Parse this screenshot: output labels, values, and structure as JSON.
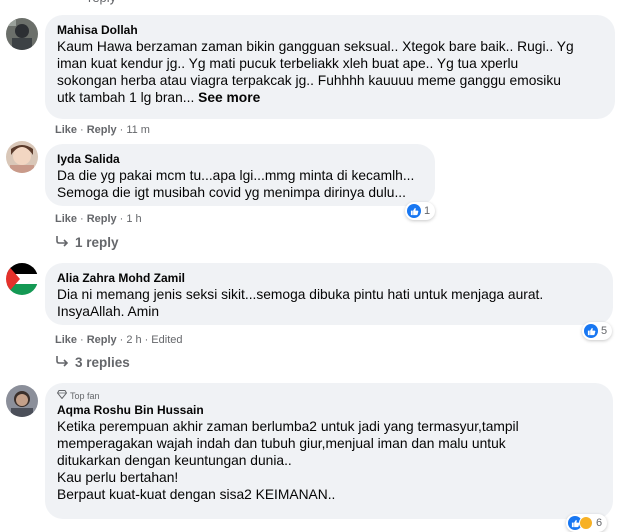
{
  "top_partial": "reply",
  "comments": [
    {
      "name": "Mahisa Dollah",
      "text": "Kaum Hawa berzaman zaman bikin gangguan seksual.. Xtegok bare baik.. Rugi.. Yg\niman kuat kendur jg.. Yg mati pucuk terbeliakk xleh buat ape.. Yg tua xperlu\nsokongan herba atau viagra terpakcak jg.. Fuhhhh kauuuu meme ganggu emosiku\nutk tambah 1 lg bran...",
      "see_more": "See more",
      "like": "Like",
      "reply": "Reply",
      "time": "11 m"
    },
    {
      "name": "Iyda Salida",
      "text": "Da die yg pakai mcm tu...apa lgi...mmg minta di kecamlh...\nSemoga die igt musibah covid yg menimpa dirinya dulu...",
      "like": "Like",
      "reply": "Reply",
      "time": "1 h",
      "reactions": "1",
      "replies": "1 reply"
    },
    {
      "name": "Alia Zahra Mohd Zamil",
      "text": "Dia ni memang jenis seksi sikit...semoga dibuka pintu hati untuk menjaga aurat.\nInsyaAllah. Amin",
      "like": "Like",
      "reply": "Reply",
      "time": "2 h",
      "edited": "Edited",
      "reactions": "5",
      "replies": "3 replies"
    },
    {
      "badge": "Top fan",
      "name": "Aqma Roshu Bin Hussain",
      "text": "Ketika perempuan akhir zaman berlumba2 untuk jadi yang termasyur,tampil\nmemperagakan wajah indah dan tubuh giur,menjual iman dan malu untuk\nditukarkan dengan keuntungan dunia..\nKau perlu bertahan!\nBerpaut kuat-kuat dengan sisa2 KEIMANAN..",
      "reactions": "6"
    }
  ],
  "colors": {
    "bubble": "#f0f2f5",
    "meta": "#65676b",
    "like_blue": "#1877f2"
  }
}
